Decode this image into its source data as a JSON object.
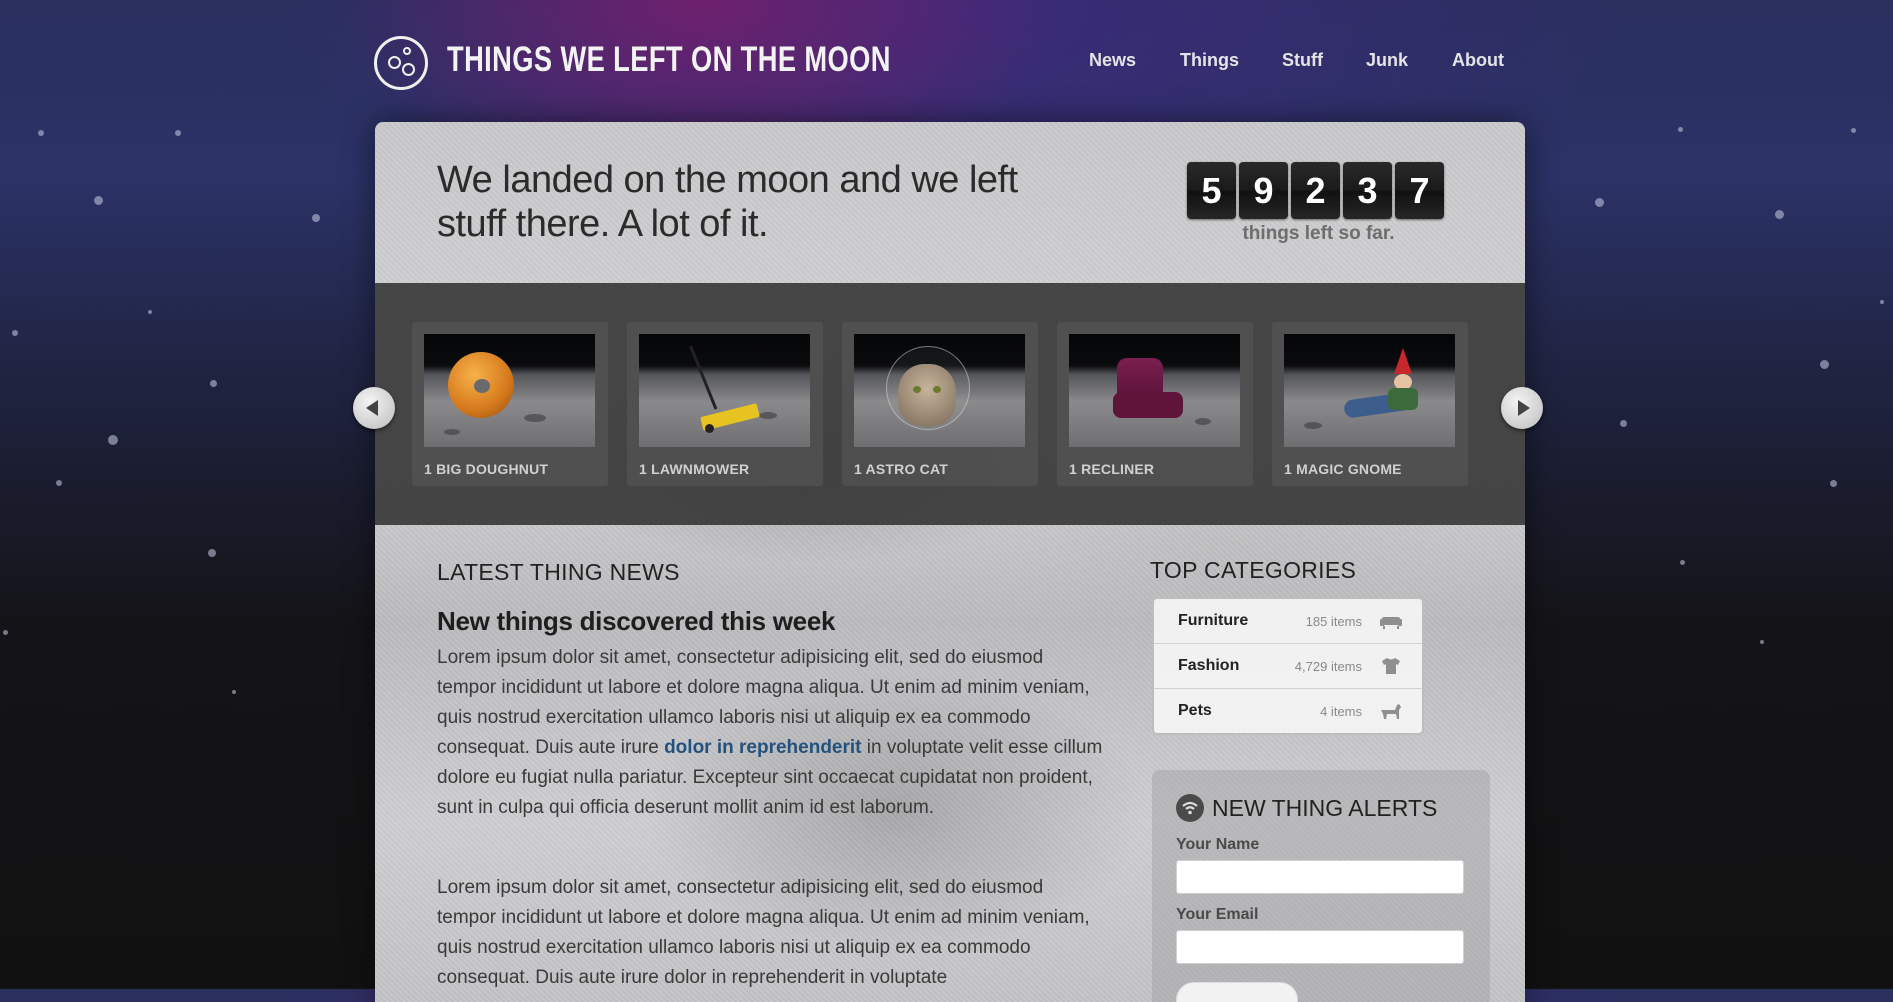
{
  "header": {
    "site_title": "THINGS WE LEFT ON THE MOON",
    "nav": [
      "News",
      "Things",
      "Stuff",
      "Junk",
      "About"
    ]
  },
  "hero": {
    "tagline": "We landed on the moon and we left stuff there. A lot of it.",
    "counter_digits": [
      "5",
      "9",
      "2",
      "3",
      "7"
    ],
    "counter_label": "things left so far."
  },
  "carousel": {
    "items": [
      {
        "label": "1 BIG DOUGHNUT",
        "icon": "doughnut-image"
      },
      {
        "label": "1 LAWNMOWER",
        "icon": "lawnmower-image"
      },
      {
        "label": "1 ASTRO CAT",
        "icon": "astro-cat-image"
      },
      {
        "label": "1 RECLINER",
        "icon": "recliner-image"
      },
      {
        "label": "1 MAGIC GNOME",
        "icon": "gnome-image"
      }
    ]
  },
  "news": {
    "heading": "LATEST THING NEWS",
    "article_title": "New things discovered this week",
    "para1_before": "Lorem ipsum dolor sit amet, consectetur adipisicing elit, sed do eiusmod tempor incididunt ut labore et dolore magna aliqua. Ut enim ad minim veniam, quis nostrud exercitation ullamco laboris nisi ut aliquip ex ea commodo consequat. Duis aute irure ",
    "para1_link": "dolor in reprehenderit",
    "para1_after": " in voluptate velit esse cillum dolore eu fugiat nulla pariatur. Excepteur sint occaecat cupidatat non proident, sunt in culpa qui officia deserunt mollit anim id est laborum.",
    "para2": "Lorem ipsum dolor sit amet, consectetur adipisicing elit, sed do eiusmod tempor incididunt ut labore et dolore magna aliqua. Ut enim ad minim veniam, quis nostrud exercitation ullamco laboris nisi ut aliquip ex ea commodo consequat. Duis aute irure dolor in reprehenderit in voluptate"
  },
  "categories": {
    "heading": "TOP CATEGORIES",
    "items": [
      {
        "name": "Furniture",
        "count": "185 items",
        "icon": "sofa-icon"
      },
      {
        "name": "Fashion",
        "count": "4,729 items",
        "icon": "shirt-icon"
      },
      {
        "name": "Pets",
        "count": "4 items",
        "icon": "dog-icon"
      }
    ]
  },
  "alerts": {
    "heading": "NEW THING ALERTS",
    "name_label": "Your Name",
    "email_label": "Your Email",
    "icon": "wifi-icon"
  },
  "colors": {
    "link": "#24527e",
    "digit_bg": "#1a1a1a",
    "carousel_bg": "#323232"
  }
}
